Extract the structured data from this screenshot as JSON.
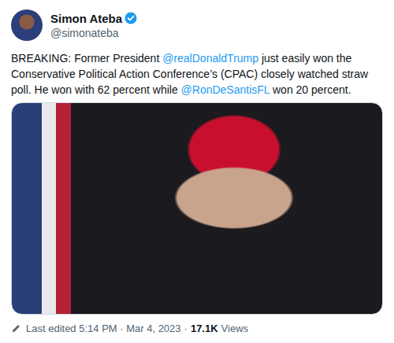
{
  "author": {
    "name": "Simon Ateba",
    "handle": "@simonateba",
    "verified": true
  },
  "tweet": {
    "segments": [
      {
        "text": "BREAKING: Former President ",
        "kind": "plain"
      },
      {
        "text": "@realDonaldTrump",
        "kind": "mention"
      },
      {
        "text": " just easily won the Conservative Political Action Conference’s (CPAC) closely watched straw poll. He won with 62 percent while ",
        "kind": "plain"
      },
      {
        "text": "@RonDeSantisFL",
        "kind": "mention"
      },
      {
        "text": " won 20 percent.",
        "kind": "plain"
      }
    ]
  },
  "footer": {
    "edited": "Last edited 5:14 PM · Mar 4, 2023",
    "separator": "·",
    "views": "17.1K",
    "views_label": "Views"
  }
}
